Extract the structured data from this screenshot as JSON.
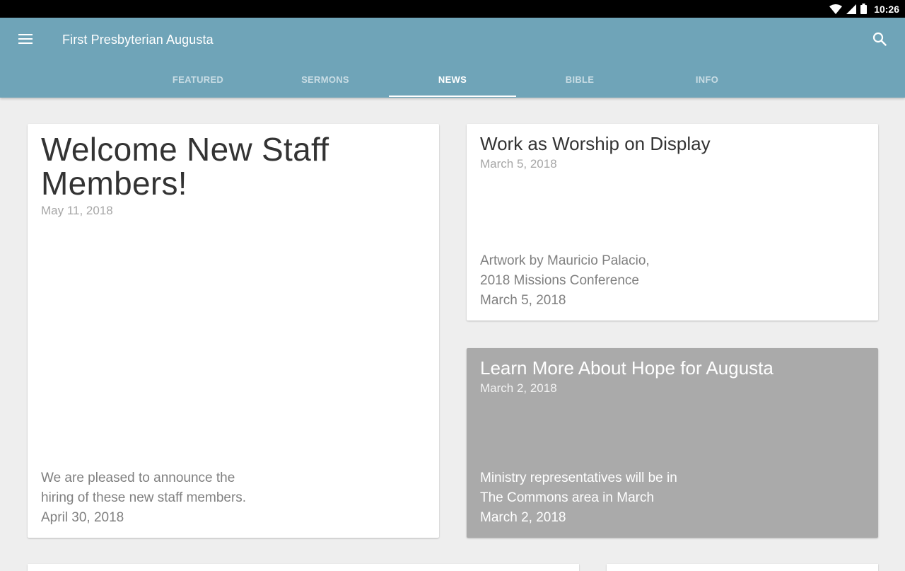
{
  "status_bar": {
    "time": "10:26",
    "icons": [
      "wifi-icon",
      "signal-icon",
      "battery-icon"
    ]
  },
  "app_bar": {
    "menu_icon": "hamburger-menu-icon",
    "title": "First Presbyterian Augusta",
    "search_icon": "search-icon",
    "color": "#6fa4b8"
  },
  "tabs": [
    {
      "label": "FEATURED",
      "active": false
    },
    {
      "label": "SERMONS",
      "active": false
    },
    {
      "label": "NEWS",
      "active": true
    },
    {
      "label": "BIBLE",
      "active": false
    },
    {
      "label": "INFO",
      "active": false
    }
  ],
  "cards": [
    {
      "title": "Welcome New Staff Members!",
      "date": "May 11, 2018",
      "desc_lines": [
        "We are pleased to announce the",
        "hiring of these new staff members.",
        "April 30, 2018"
      ]
    },
    {
      "title": "Work as Worship on Display",
      "date": "March 5, 2018",
      "desc_lines": [
        "Artwork by Mauricio Palacio,",
        "2018 Missions Conference",
        "March 5, 2018"
      ]
    },
    {
      "title": "Learn More About Hope for Augusta",
      "date": "March 2, 2018",
      "desc_lines": [
        "Ministry representatives will be in",
        "The Commons area in March",
        "March 2, 2018"
      ]
    }
  ]
}
